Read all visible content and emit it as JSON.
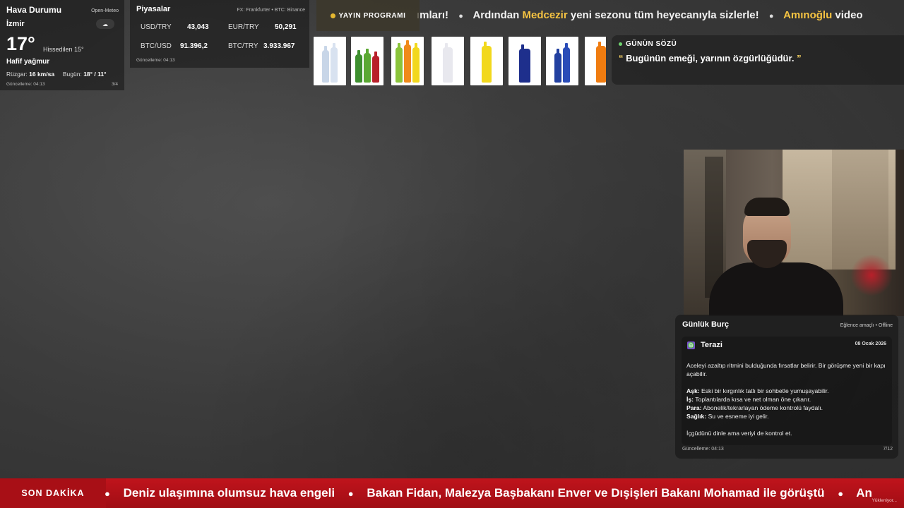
{
  "weather": {
    "title": "Hava Durumu",
    "source": "Open-Meteo",
    "city": "İzmir",
    "icon": "cloud-rain-icon",
    "temperature": "17°",
    "feels_like": "Hissedilen 15°",
    "condition": "Hafif yağmur",
    "wind_label": "Rüzgar:",
    "wind_value": "16 km/sa",
    "today_label": "Bugün:",
    "today_value": "18° / 11°",
    "updated": "Güncelleme: 04:13",
    "page": "3/4"
  },
  "markets": {
    "title": "Piyasalar",
    "source": "FX: Frankfurter • BTC: Binance",
    "items": [
      {
        "label": "USD/TRY",
        "value": "43,043"
      },
      {
        "label": "EUR/TRY",
        "value": "50,291"
      },
      {
        "label": "BTC/USD",
        "value": "91.396,2"
      },
      {
        "label": "BTC/TRY",
        "value": "3.933.967"
      }
    ],
    "updated": "Güncelleme: 04:13"
  },
  "program_button": "YAYIN PROGRAMI",
  "top_ticker": {
    "part1": "ımları!",
    "part2_pre": "Ardından",
    "part2_hl": "Medcezir",
    "part2_post": "yeni sezonu tüm heyecanıyla sizlerle!",
    "part3_hl": "Amınoğlu",
    "part3_post": "video"
  },
  "products": {
    "colors": [
      "#c8d6e8",
      "#3d8f2e",
      "#f08a1a",
      "#e8e8ee",
      "#f2d81c",
      "#1e2f8c",
      "#2240a0",
      "#f07c10"
    ]
  },
  "quote": {
    "label": "GÜNÜN SÖZÜ",
    "open_mark": "“",
    "text": "Bugünün emeği, yarının özgürlüğüdür.",
    "close_mark": "”"
  },
  "horoscope": {
    "title": "Günlük Burç",
    "status": "Eğlence amaçlı • Offline",
    "sign_icon": "♎",
    "sign": "Terazi",
    "date": "08 Ocak 2026",
    "intro": "Aceleyi azaltıp ritmini bulduğunda fırsatlar belirir. Bir görüşme yeni bir kapı açabilir.",
    "lines": [
      {
        "k": "Aşk:",
        "v": "Eski bir kırgınlık tatlı bir sohbetle yumuşayabilir."
      },
      {
        "k": "İş:",
        "v": "Toplantılarda kısa ve net olman öne çıkarır."
      },
      {
        "k": "Para:",
        "v": "Abonelik/tekrarlayan ödeme kontrolü faydalı."
      },
      {
        "k": "Sağlık:",
        "v": "Su ve esneme iyi gelir."
      }
    ],
    "advice": "İçgüdünü dinle ama veriyi de kontrol et.",
    "updated": "Güncelleme: 04:13",
    "page": "7/12"
  },
  "breaking": {
    "label": "SON DAKİKA",
    "items": [
      "Deniz ulaşımına olumsuz hava engeli",
      "Bakan Fidan, Malezya Başbakanı Enver ve Dışişleri Bakanı Mohamad ile görüştü",
      "An"
    ],
    "loading": "Yükleniyor..."
  }
}
